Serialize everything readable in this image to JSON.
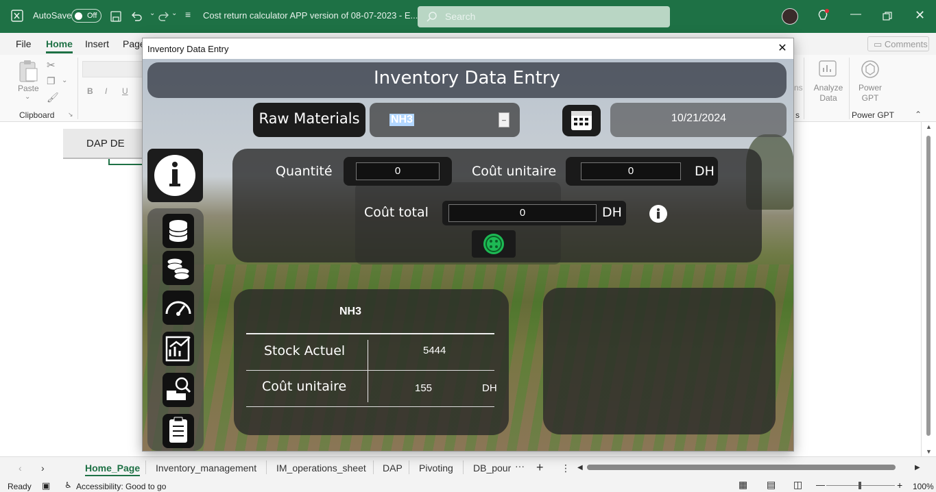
{
  "titlebar": {
    "autosave_label": "AutoSave",
    "autosave_state": "Off",
    "document_title": "Cost return calculator APP version of 08-07-2023  -  E...",
    "search_placeholder": "Search"
  },
  "ribbon_tabs": [
    "File",
    "Home",
    "Insert",
    "Page"
  ],
  "ribbon": {
    "paste_label": "Paste",
    "clipboard_label": "Clipboard",
    "analyze_data_label": "Analyze Data",
    "power_gpt_label": "Power GPT",
    "power_gpt_group": "Power GPT",
    "comments_label": "Comments",
    "partial_label": "ns",
    "partial_label2": "s"
  },
  "sheet": {
    "cell_text": "DAP DE"
  },
  "sheet_tabs": [
    "Home_Page",
    "Inventory_management",
    "IM_operations_sheet",
    "DAP",
    "Pivoting",
    "DB_pour"
  ],
  "statusbar": {
    "ready": "Ready",
    "accessibility": "Accessibility: Good to go",
    "zoom": "100%"
  },
  "dialog": {
    "window_title": "Inventory Data Entry",
    "header": "Inventory Data Entry",
    "category_label": "Raw Materials",
    "material_value": "NH3",
    "date_value": "10/21/2024",
    "quantity_label": "Quantité",
    "quantity_value": "0",
    "unit_cost_label": "Coût unitaire",
    "unit_cost_value": "0",
    "unit_cost_currency": "DH",
    "total_cost_label": "Coût total",
    "total_cost_value": "0",
    "total_cost_currency": "DH",
    "summary": {
      "material_name": "NH3",
      "stock_label": "Stock Actuel",
      "stock_value": "5444",
      "unit_cost_label": "Coût unitaire",
      "unit_cost_value": "155",
      "unit_cost_currency": "DH"
    }
  },
  "colors": {
    "excel_green": "#1e7145",
    "confirm_green": "#1db954",
    "panel_dark": "#2a2a2a"
  }
}
